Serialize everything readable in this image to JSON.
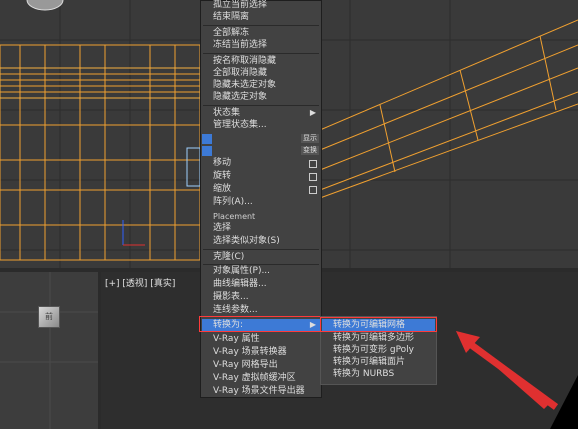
{
  "viewport": {
    "label": "[+] [透视] [真实]"
  },
  "cube_label": "前",
  "main_menu": [
    "孤立当前选择",
    "结束隔离",
    "全部解冻",
    "冻结当前选择",
    "按名称取消隐藏",
    "全部取消隐藏",
    "隐藏未选定对象",
    "隐藏选定对象",
    "状态集",
    "管理状态集...",
    "移动",
    "旋转",
    "缩放",
    "阵列(A)...",
    "Placement",
    "选择",
    "选择类似对象(S)",
    "克隆(C)",
    "对象属性(P)...",
    "曲线编辑器...",
    "摄影表...",
    "连线参数...",
    "转换为:",
    "V-Ray 属性",
    "V-Ray 场景转换器",
    "V-Ray 网格导出",
    "V-Ray 虚拟帧缓冲区",
    "V-Ray 场景文件导出器"
  ],
  "side_buttons": [
    "显示",
    "变换"
  ],
  "sub_menu": [
    "转换为可编辑网格",
    "转换为可编辑多边形",
    "转换为可变形 gPoly",
    "转换为可编辑面片",
    "转换为 NURBS"
  ],
  "colors": {
    "highlight": "#3d7ad6",
    "selection_box": "#ff3b3b",
    "arrow": "#e03030",
    "wireframe": "#f0a030"
  }
}
